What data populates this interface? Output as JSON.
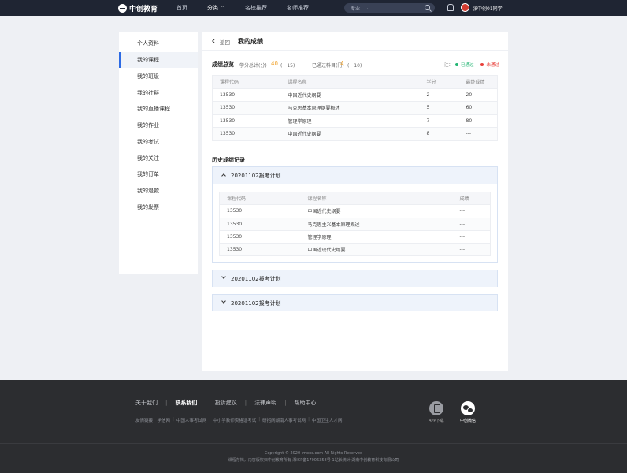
{
  "nav": {
    "brand": "中创教育",
    "items": [
      {
        "label": "首页",
        "active": false
      },
      {
        "label": "分类",
        "active": true
      },
      {
        "label": "名校推荐",
        "active": false
      },
      {
        "label": "名师推荐",
        "active": false
      }
    ],
    "category_chevron": "⌃",
    "search": {
      "scope": "专业",
      "placeholder": ""
    },
    "username": "张中创01同学"
  },
  "sidebar": {
    "items": [
      {
        "label": "个人资料"
      },
      {
        "label": "我的课程",
        "active": true
      },
      {
        "label": "我的班级"
      },
      {
        "label": "我的社群"
      },
      {
        "label": "我的直播课程"
      },
      {
        "label": "我的作业"
      },
      {
        "label": "我的考试"
      },
      {
        "label": "我的关注"
      },
      {
        "label": "我的订单"
      },
      {
        "label": "我的退款"
      },
      {
        "label": "我的发票"
      }
    ]
  },
  "page": {
    "back_label": "返回",
    "title": "我的成绩"
  },
  "summary": {
    "title": "成绩总览",
    "credit_label": "学分总计(分)",
    "credit_value": "40",
    "credit_delta": "(一15)",
    "passed_label": "已通过科目(门)",
    "passed_value": "4",
    "passed_delta": "(一10)",
    "legend_prefix": "注：",
    "legend_pass": "已通过",
    "legend_fail": "未通过",
    "pass_color": "#22b573",
    "fail_color": "#e8403a"
  },
  "overview_table": {
    "headers": [
      "课程代码",
      "课程名称",
      "学分",
      "最终成绩"
    ],
    "rows": [
      [
        "13530",
        "中国近代史纲要",
        "2",
        "20"
      ],
      [
        "13530",
        "马克思基本原理纲要概述",
        "5",
        "60"
      ],
      [
        "13530",
        "管理学原理",
        "7",
        "80"
      ],
      [
        "13530",
        "中国近代史纲要",
        "8",
        "---"
      ]
    ]
  },
  "history": {
    "title": "历史成绩记录",
    "plans": [
      {
        "title": "20201102报考计划",
        "expanded": true,
        "headers": [
          "课程代码",
          "课程名称",
          "成绩"
        ],
        "rows": [
          [
            "13530",
            "中国近代史纲要",
            "---"
          ],
          [
            "13530",
            "马克思主义基本原理概述",
            "---"
          ],
          [
            "13530",
            "管理学原理",
            "---"
          ],
          [
            "13530",
            "中国近现代史纲要",
            "---"
          ]
        ]
      },
      {
        "title": "20201102报考计划",
        "expanded": false
      },
      {
        "title": "20201102报考计划",
        "expanded": false
      }
    ]
  },
  "footer": {
    "links": [
      {
        "label": "关于我们",
        "bold": false
      },
      {
        "label": "联系我们",
        "bold": true
      },
      {
        "label": "投诉建议",
        "bold": false
      },
      {
        "label": "法律声明",
        "bold": false
      },
      {
        "label": "帮助中心",
        "bold": false
      }
    ],
    "friends_label": "友情链接：",
    "friends": [
      "学信网",
      "中国人事考试网",
      "中小学教师资格证考试",
      "研招网湖南人事考试网",
      "中国卫生人才网"
    ],
    "app_label": "APP下载",
    "wechat_label": "中创微信",
    "copyright": "Copyright © 2020 imooc.com All Rights Reserved",
    "icp": "课程存档，内容版权归中创教育所有   湘ICP备17006358号-1站长统计  湖南中创教育科技有限公司"
  }
}
